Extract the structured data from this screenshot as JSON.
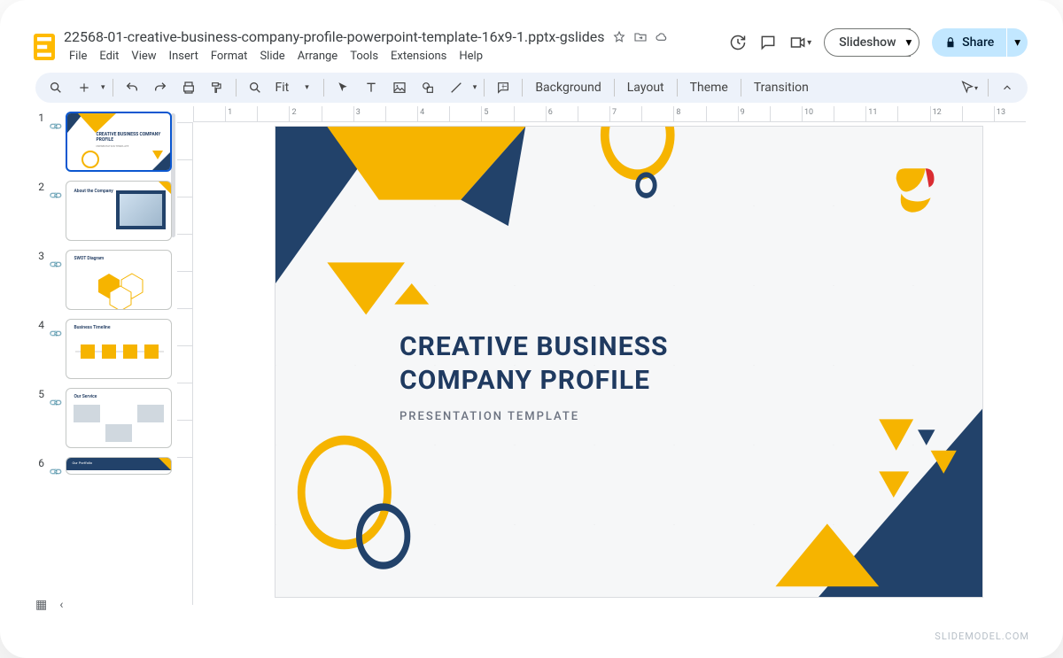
{
  "document": {
    "name": "22568-01-creative-business-company-profile-powerpoint-template-16x9-1.pptx-gslides"
  },
  "menubar": [
    "File",
    "Edit",
    "View",
    "Insert",
    "Format",
    "Slide",
    "Arrange",
    "Tools",
    "Extensions",
    "Help"
  ],
  "titlebar_buttons": {
    "slideshow": "Slideshow",
    "share": "Share"
  },
  "toolbar": {
    "zoom_label": "Fit",
    "buttons": {
      "background": "Background",
      "layout": "Layout",
      "theme": "Theme",
      "transition": "Transition"
    }
  },
  "ruler_marks": [
    "",
    "1",
    "",
    "2",
    "",
    "3",
    "",
    "4",
    "",
    "5",
    "",
    "6",
    "",
    "7",
    "",
    "8",
    "",
    "9",
    "",
    "10",
    "",
    "11",
    "",
    "12",
    "",
    "13"
  ],
  "slide": {
    "title_line1": "CREATIVE BUSINESS",
    "title_line2": "COMPANY PROFILE",
    "subtitle": "PRESENTATION TEMPLATE"
  },
  "filmstrip": [
    {
      "num": "1",
      "label": "CREATIVE BUSINESS COMPANY PROFILE",
      "sub": "PRESENTATION TEMPLATE",
      "active": true
    },
    {
      "num": "2",
      "label": "About the Company"
    },
    {
      "num": "3",
      "label": "SWOT Diagram"
    },
    {
      "num": "4",
      "label": "Business Timeline"
    },
    {
      "num": "5",
      "label": "Our Service"
    },
    {
      "num": "6",
      "label": "Our Portfolio"
    }
  ],
  "watermark": "SLIDEMODEL.COM",
  "colors": {
    "navy": "#22426a",
    "gold": "#f6b400",
    "red": "#da2c32",
    "share_bg": "#c2e7ff",
    "toolbar_bg": "#edf2fa"
  }
}
